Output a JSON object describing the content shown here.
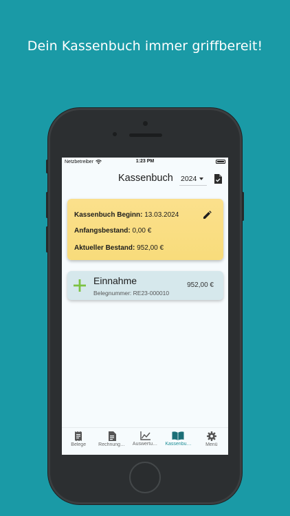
{
  "headline": "Dein Kassenbuch immer griffbereit!",
  "status": {
    "carrier": "Netzbetreiber",
    "time": "1:23 PM"
  },
  "appbar": {
    "title": "Kassenbuch",
    "year": "2024"
  },
  "summary": {
    "begin_label": "Kassenbuch Beginn:",
    "begin_value": "13.03.2024",
    "start_label": "Anfangsbestand:",
    "start_value": "0,00 €",
    "current_label": "Aktueller Bestand:",
    "current_value": "952,00 €"
  },
  "entry": {
    "title": "Einnahme",
    "receipt": "Belegnummer: RE23-000010",
    "amount": "952,00 €"
  },
  "nav": {
    "items": [
      {
        "label": "Belege",
        "icon": "receipt-icon"
      },
      {
        "label": "Rechnung…",
        "icon": "invoice-icon"
      },
      {
        "label": "Auswertu…",
        "icon": "chart-icon"
      },
      {
        "label": "Kassenbu…",
        "icon": "book-icon"
      },
      {
        "label": "Menü",
        "icon": "gear-icon"
      }
    ],
    "active_index": 3
  },
  "colors": {
    "background": "#1a9aa6",
    "summary_card": "#f8dc7b",
    "entry_card": "#d6e8ec",
    "plus": "#7cc242",
    "accent": "#1c8d95"
  }
}
